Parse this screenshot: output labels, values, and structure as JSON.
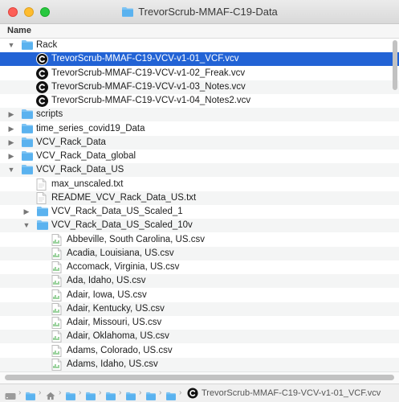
{
  "window": {
    "title": "TrevorScrub-MMAF-C19-Data"
  },
  "header": {
    "column_name": "Name"
  },
  "rows": [
    {
      "label": "Rack",
      "type": "folder",
      "disclosure": "open",
      "alt": false
    },
    {
      "label": "TrevorScrub-MMAF-C19-VCV-v1-01_VCF.vcv",
      "type": "vcv",
      "disclosure": "none",
      "alt": false,
      "selected": true
    },
    {
      "label": "TrevorScrub-MMAF-C19-VCV-v1-02_Freak.vcv",
      "type": "vcv",
      "disclosure": "none",
      "alt": false
    },
    {
      "label": "TrevorScrub-MMAF-C19-VCV-v1-03_Notes.vcv",
      "type": "vcv",
      "disclosure": "none",
      "alt": true
    },
    {
      "label": "TrevorScrub-MMAF-C19-VCV-v1-04_Notes2.vcv",
      "type": "vcv",
      "disclosure": "none",
      "alt": false
    },
    {
      "label": "scripts",
      "type": "folder",
      "disclosure": "closed",
      "alt": true
    },
    {
      "label": "time_series_covid19_Data",
      "type": "folder",
      "disclosure": "closed",
      "alt": false
    },
    {
      "label": "VCV_Rack_Data",
      "type": "folder",
      "disclosure": "closed",
      "alt": true
    },
    {
      "label": "VCV_Rack_Data_global",
      "type": "folder",
      "disclosure": "closed",
      "alt": false
    },
    {
      "label": "VCV_Rack_Data_US",
      "type": "folder",
      "disclosure": "open",
      "alt": true
    },
    {
      "label": "max_unscaled.txt",
      "type": "txt",
      "disclosure": "none",
      "alt": false
    },
    {
      "label": "README_VCV_Rack_Data_US.txt",
      "type": "txt",
      "disclosure": "none",
      "alt": true
    },
    {
      "label": "VCV_Rack_Data_US_Scaled_1",
      "type": "folder",
      "disclosure": "closed",
      "alt": false
    },
    {
      "label": "VCV_Rack_Data_US_Scaled_10v",
      "type": "folder",
      "disclosure": "open",
      "alt": true
    },
    {
      "label": "Abbeville, South Carolina, US.csv",
      "type": "csv",
      "disclosure": "none",
      "alt": false
    },
    {
      "label": "Acadia, Louisiana, US.csv",
      "type": "csv",
      "disclosure": "none",
      "alt": true
    },
    {
      "label": "Accomack, Virginia, US.csv",
      "type": "csv",
      "disclosure": "none",
      "alt": false
    },
    {
      "label": "Ada, Idaho, US.csv",
      "type": "csv",
      "disclosure": "none",
      "alt": true
    },
    {
      "label": "Adair, Iowa, US.csv",
      "type": "csv",
      "disclosure": "none",
      "alt": false
    },
    {
      "label": "Adair, Kentucky, US.csv",
      "type": "csv",
      "disclosure": "none",
      "alt": true
    },
    {
      "label": "Adair, Missouri, US.csv",
      "type": "csv",
      "disclosure": "none",
      "alt": false
    },
    {
      "label": "Adair, Oklahoma, US.csv",
      "type": "csv",
      "disclosure": "none",
      "alt": true
    },
    {
      "label": "Adams, Colorado, US.csv",
      "type": "csv",
      "disclosure": "none",
      "alt": false
    },
    {
      "label": "Adams, Idaho, US.csv",
      "type": "csv",
      "disclosure": "none",
      "alt": true
    }
  ],
  "pathbar": {
    "items": [
      "hard-drive-icon",
      "folder-icon",
      "home-icon",
      "folder-icon",
      "folder-icon",
      "folder-icon",
      "folder-icon",
      "folder-icon",
      "folder-icon"
    ],
    "current": "TrevorScrub-MMAF-C19-VCV-v1-01_VCF.vcv"
  },
  "colors": {
    "selection": "#2263d5",
    "folder": "#5ab2ef",
    "alternate_row": "#f4f5f5"
  }
}
